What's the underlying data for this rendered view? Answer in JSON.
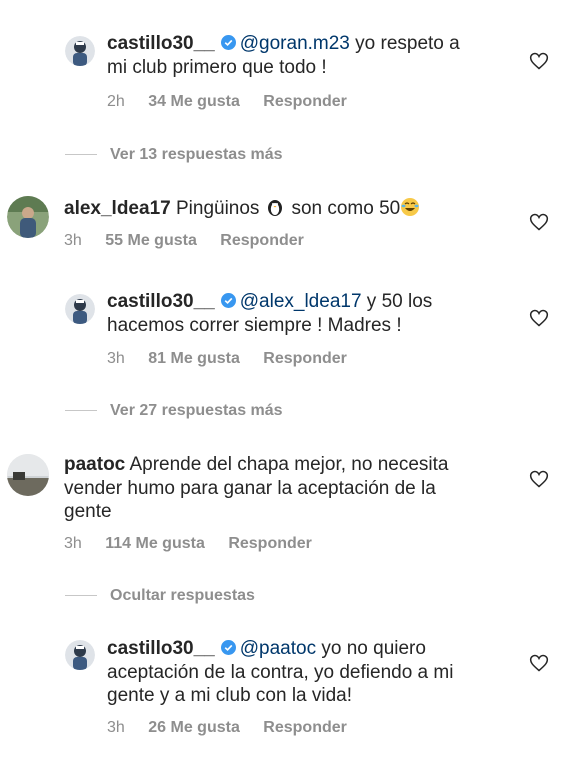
{
  "comments": [
    {
      "username": "castillo30__",
      "mention": "@goran.m23",
      "text_line1": " yo respeto a",
      "text_line2": "mi club primero que todo !",
      "time": "2h",
      "likes": "34 Me gusta",
      "reply": "Responder"
    },
    {
      "username": "alex_ldea17",
      "text_a": "Pingüinos",
      "text_b": "son como 50",
      "time": "3h",
      "likes": "55 Me gusta",
      "reply": "Responder"
    },
    {
      "username": "castillo30__",
      "mention": "@alex_ldea17",
      "text_line1": " y 50 los",
      "text_line2": "hacemos correr siempre ! Madres !",
      "time": "3h",
      "likes": "81 Me gusta",
      "reply": "Responder"
    },
    {
      "username": "paatoc",
      "text_line1": " Aprende del chapa mejor, no necesita",
      "text_line2": "vender humo para ganar la aceptación de la",
      "text_line3": "gente",
      "time": "3h",
      "likes": "114 Me gusta",
      "reply": "Responder"
    },
    {
      "username": "castillo30__",
      "mention": "@paatoc",
      "text_line1": " yo no quiero",
      "text_line2": "aceptación de la contra, yo defiendo a mi",
      "text_line3": "gente y a mi club con la vida!",
      "time": "3h",
      "likes": "26 Me gusta",
      "reply": "Responder"
    }
  ],
  "view_more_1": "Ver 13 respuestas más",
  "view_more_2": "Ver 27 respuestas más",
  "hide_replies": "Ocultar respuestas",
  "icons": {
    "like": "heart-outline-icon",
    "verified": "verified-badge-icon"
  },
  "colors": {
    "mention": "#00376b",
    "verified": "#3897f0",
    "meta": "#8e8e8e"
  }
}
